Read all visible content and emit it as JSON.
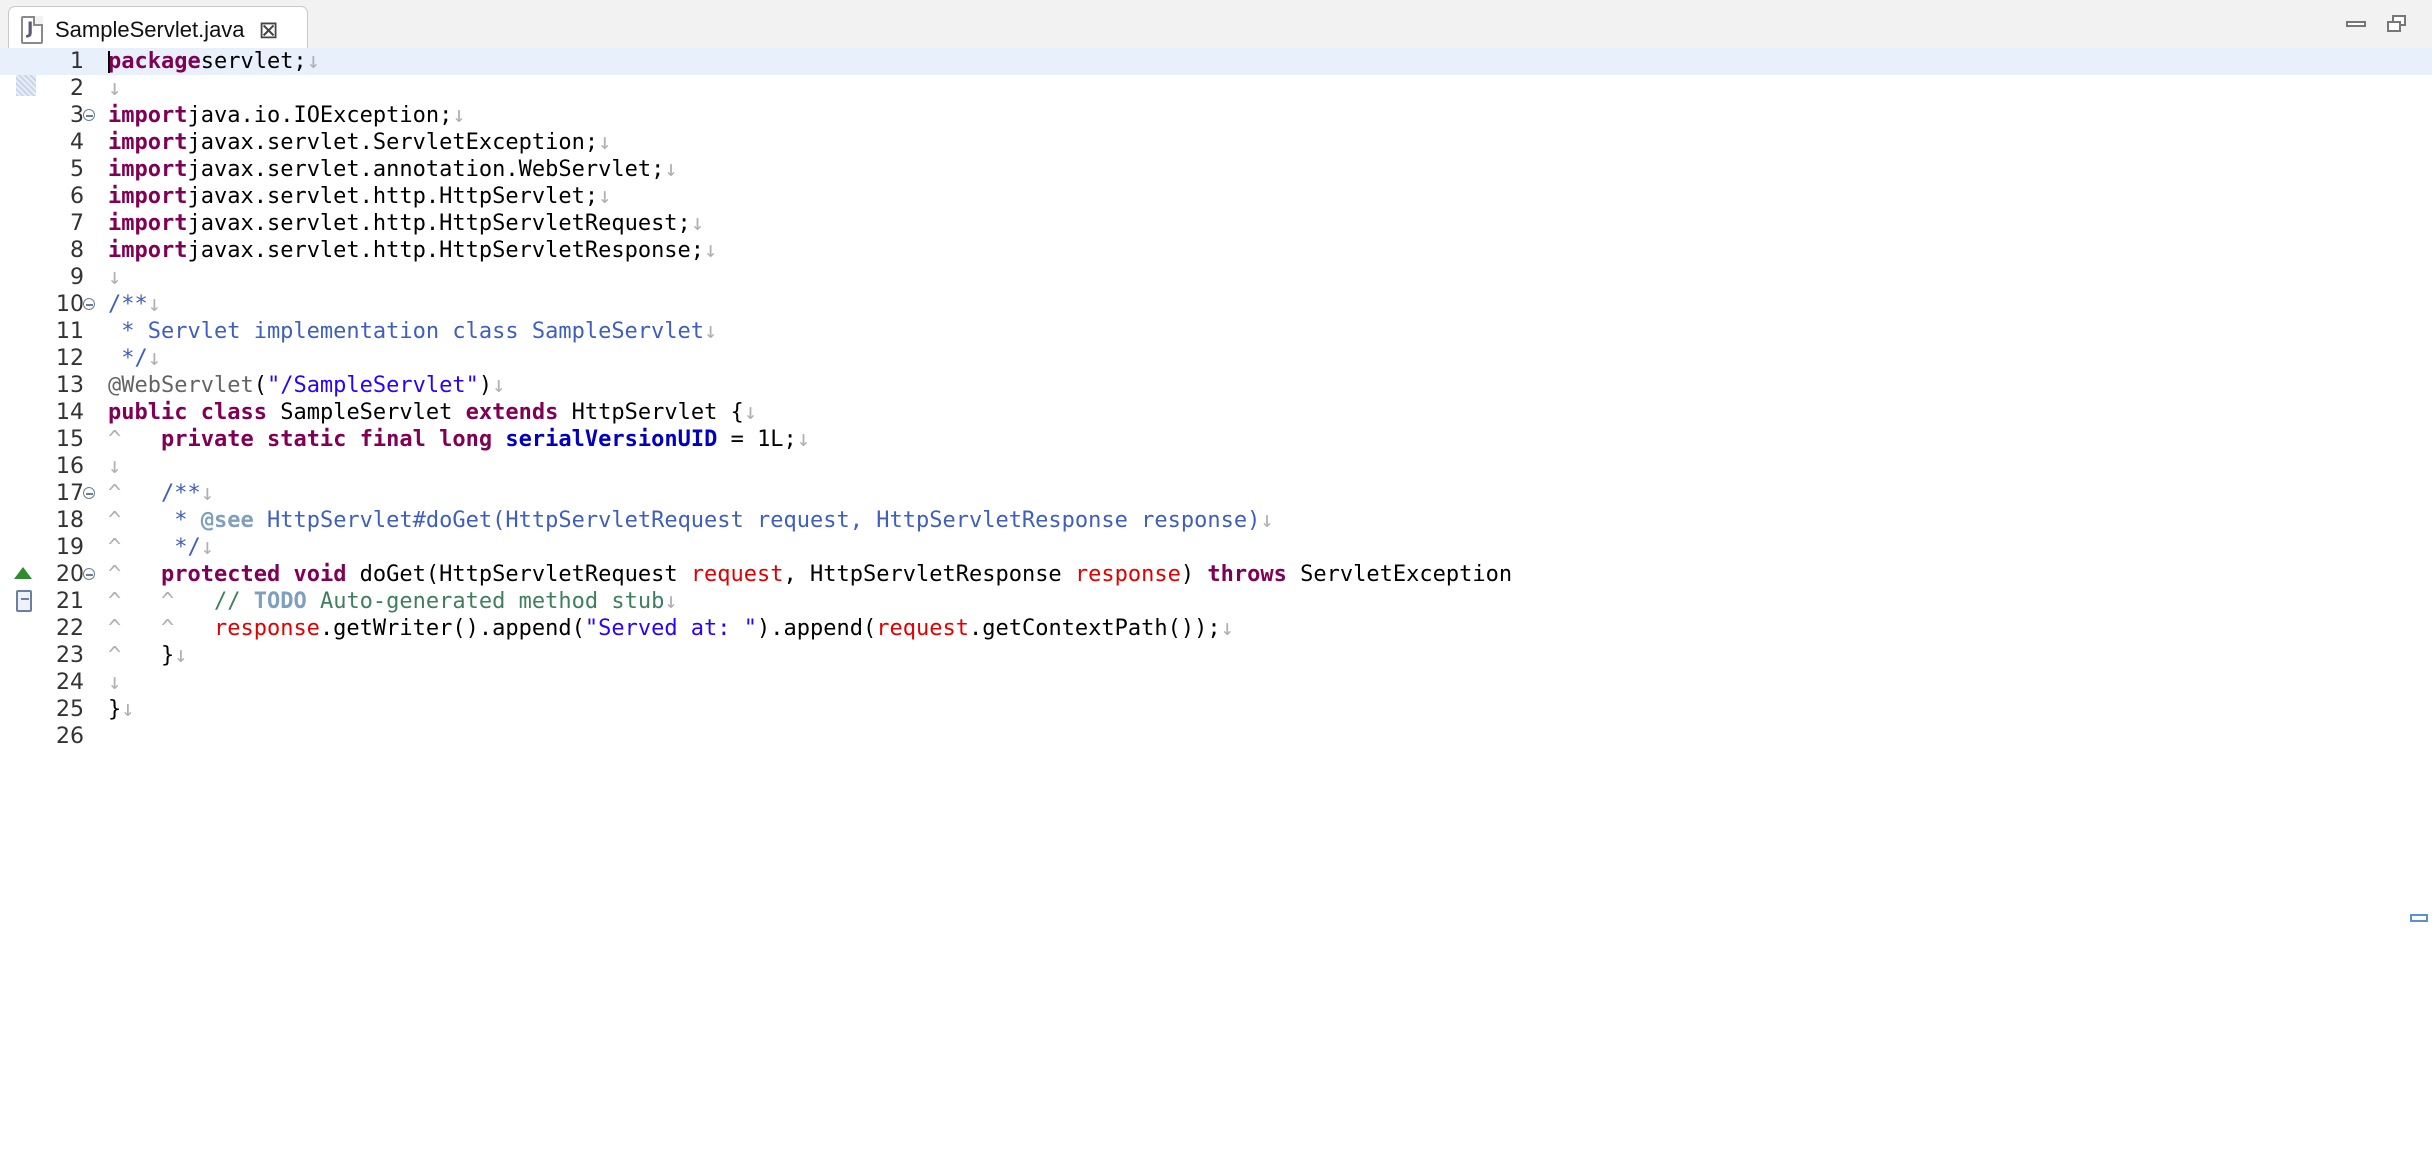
{
  "tab": {
    "filename": "SampleServlet.java"
  },
  "editor": {
    "lines": [
      {
        "n": "1",
        "tokens": [
          [
            "kw",
            "package"
          ],
          [
            "",
            "servlet;"
          ],
          [
            "ws",
            "↓"
          ]
        ]
      },
      {
        "n": "2",
        "tokens": [
          [
            "ws",
            "↓"
          ]
        ]
      },
      {
        "n": "3",
        "tokens": [
          [
            "kw",
            "import"
          ],
          [
            "",
            "java.io.IOException;"
          ],
          [
            "ws",
            "↓"
          ]
        ]
      },
      {
        "n": "4",
        "tokens": [
          [
            "kw",
            "import"
          ],
          [
            "",
            "javax.servlet.ServletException;"
          ],
          [
            "ws",
            "↓"
          ]
        ]
      },
      {
        "n": "5",
        "tokens": [
          [
            "kw",
            "import"
          ],
          [
            "",
            "javax.servlet.annotation.WebServlet;"
          ],
          [
            "ws",
            "↓"
          ]
        ]
      },
      {
        "n": "6",
        "tokens": [
          [
            "kw",
            "import"
          ],
          [
            "",
            "javax.servlet.http.HttpServlet;"
          ],
          [
            "ws",
            "↓"
          ]
        ]
      },
      {
        "n": "7",
        "tokens": [
          [
            "kw",
            "import"
          ],
          [
            "",
            "javax.servlet.http.HttpServletRequest;"
          ],
          [
            "ws",
            "↓"
          ]
        ]
      },
      {
        "n": "8",
        "tokens": [
          [
            "kw",
            "import"
          ],
          [
            "",
            "javax.servlet.http.HttpServletResponse;"
          ],
          [
            "ws",
            "↓"
          ]
        ]
      },
      {
        "n": "9",
        "tokens": [
          [
            "ws",
            "↓"
          ]
        ]
      },
      {
        "n": "10",
        "tokens": [
          [
            "doc",
            "/**"
          ],
          [
            "ws",
            "↓"
          ]
        ]
      },
      {
        "n": "11",
        "tokens": [
          [
            "doc",
            " * Servlet implementation class SampleServlet"
          ],
          [
            "ws",
            "↓"
          ]
        ]
      },
      {
        "n": "12",
        "tokens": [
          [
            "doc",
            " */"
          ],
          [
            "ws",
            "↓"
          ]
        ]
      },
      {
        "n": "13",
        "tokens": [
          [
            "ann",
            "@WebServlet"
          ],
          [
            "",
            "("
          ],
          [
            "str",
            "\"/SampleServlet\""
          ],
          [
            "",
            ")"
          ],
          [
            "ws",
            "↓"
          ]
        ]
      },
      {
        "n": "14",
        "tokens": [
          [
            "kw",
            "public"
          ],
          [
            "",
            " "
          ],
          [
            "kw",
            "class"
          ],
          [
            "",
            " SampleServlet "
          ],
          [
            "kw",
            "extends"
          ],
          [
            "",
            " HttpServlet {"
          ],
          [
            "ws",
            "↓"
          ]
        ]
      },
      {
        "n": "15",
        "tokens": [
          [
            "ws",
            "^   "
          ],
          [
            "kw",
            "private"
          ],
          [
            "",
            " "
          ],
          [
            "kw",
            "static"
          ],
          [
            "",
            " "
          ],
          [
            "kw",
            "final"
          ],
          [
            "",
            " "
          ],
          [
            "kw",
            "long"
          ],
          [
            "",
            " "
          ],
          [
            "field",
            "serialVersionUID"
          ],
          [
            "",
            " = 1L;"
          ],
          [
            "ws",
            "↓"
          ]
        ]
      },
      {
        "n": "16",
        "tokens": [
          [
            "ws",
            "↓"
          ]
        ]
      },
      {
        "n": "17",
        "tokens": [
          [
            "ws",
            "^   "
          ],
          [
            "doc",
            "/**"
          ],
          [
            "ws",
            "↓"
          ]
        ]
      },
      {
        "n": "18",
        "tokens": [
          [
            "ws",
            "^   "
          ],
          [
            "doc",
            " * "
          ],
          [
            "doctag",
            "@see"
          ],
          [
            "doc",
            " HttpServlet#doGet(HttpServletRequest request, HttpServletResponse response)"
          ],
          [
            "ws",
            "↓"
          ]
        ]
      },
      {
        "n": "19",
        "tokens": [
          [
            "ws",
            "^   "
          ],
          [
            "doc",
            " */"
          ],
          [
            "ws",
            "↓"
          ]
        ]
      },
      {
        "n": "20",
        "tokens": [
          [
            "ws",
            "^   "
          ],
          [
            "kw",
            "protected"
          ],
          [
            "",
            " "
          ],
          [
            "kw",
            "void"
          ],
          [
            "",
            " doGet(HttpServletRequest "
          ],
          [
            "param",
            "request"
          ],
          [
            "",
            ", HttpServletResponse "
          ],
          [
            "param",
            "response"
          ],
          [
            "",
            ") "
          ],
          [
            "kw",
            "throws"
          ],
          [
            "",
            " ServletException"
          ]
        ]
      },
      {
        "n": "21",
        "tokens": [
          [
            "ws",
            "^   ^   "
          ],
          [
            "com",
            "// "
          ],
          [
            "todo",
            "TODO"
          ],
          [
            "com",
            " Auto-generated method stub"
          ],
          [
            "ws",
            "↓"
          ]
        ]
      },
      {
        "n": "22",
        "tokens": [
          [
            "ws",
            "^   ^   "
          ],
          [
            "param",
            "response"
          ],
          [
            "",
            ".getWriter().append("
          ],
          [
            "str",
            "\"Served at: \""
          ],
          [
            "",
            ").append("
          ],
          [
            "param",
            "request"
          ],
          [
            "",
            ".getContextPath());"
          ],
          [
            "ws",
            "↓"
          ]
        ]
      },
      {
        "n": "23",
        "tokens": [
          [
            "ws",
            "^   "
          ],
          [
            "",
            "}"
          ],
          [
            "ws",
            "↓"
          ]
        ]
      },
      {
        "n": "24",
        "tokens": [
          [
            "ws",
            "↓"
          ]
        ]
      },
      {
        "n": "25",
        "tokens": [
          [
            "",
            "}"
          ],
          [
            "ws",
            "↓"
          ]
        ]
      },
      {
        "n": "26",
        "tokens": []
      }
    ],
    "current_line": "1",
    "fold_lines": [
      "3",
      "10",
      "17",
      "20"
    ],
    "override_line": "20",
    "task_line": "21"
  },
  "colors": {
    "keyword": "#7f0055",
    "annotation": "#646464",
    "string": "#2a00ff",
    "javadoc": "#3f5fbf",
    "javadoc_tag": "#7f9fbf",
    "comment": "#3f7f5f",
    "field": "#0000c0",
    "parameter": "#e00000",
    "whitespace": "#b0b0b0",
    "current_line_bg": "#e8f0fb"
  },
  "icons": {
    "tab": "java-file-icon",
    "close": "close-icon",
    "minimize": "minimize-icon",
    "maximize": "maximize-icon",
    "override": "override-triangle-icon",
    "task": "task-marker-icon",
    "fold": "fold-collapse-icon"
  }
}
